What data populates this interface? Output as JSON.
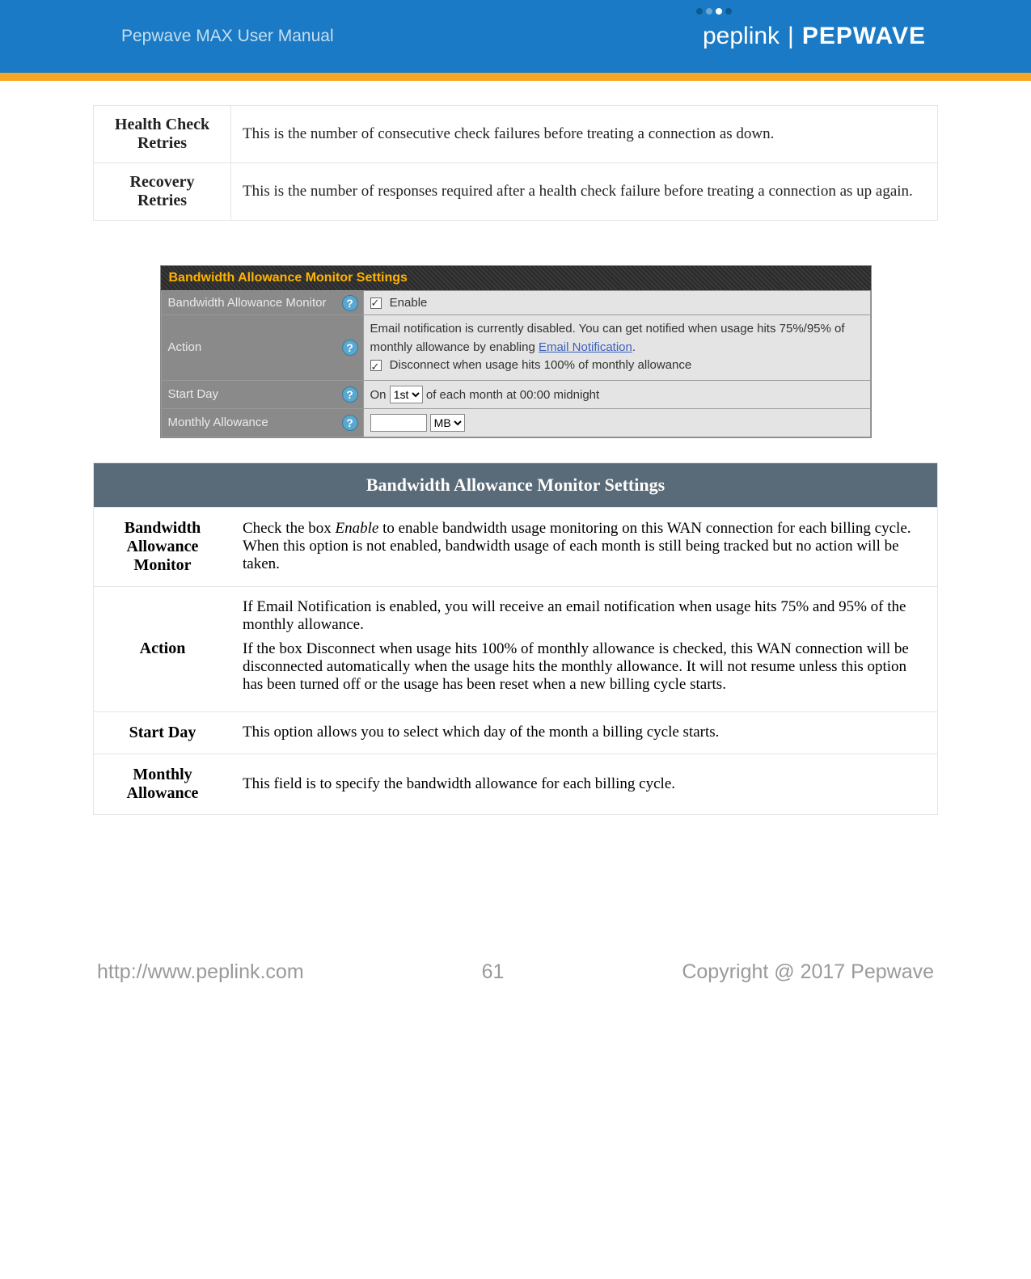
{
  "header": {
    "title": "Pepwave MAX User Manual",
    "brand_left": "peplink",
    "brand_right": "PEPWAVE"
  },
  "desc_table": [
    {
      "label": "Health Check Retries",
      "text": "This is the number of consecutive check failures before treating a connection as down."
    },
    {
      "label": "Recovery Retries",
      "text": "This is the number of responses required after a health check failure before treating a connection as up again."
    }
  ],
  "settings_panel": {
    "title": "Bandwidth Allowance Monitor Settings",
    "rows": {
      "bam": {
        "key": "Bandwidth Allowance Monitor",
        "enable_label": "Enable",
        "enable_checked": true
      },
      "action": {
        "key": "Action",
        "text_prefix": "Email notification is currently disabled. You can get notified when usage hits 75%/95% of monthly allowance by enabling ",
        "link": "Email Notification",
        "text_suffix": ".",
        "disconnect_label": "Disconnect when usage hits 100% of monthly allowance",
        "disconnect_checked": true
      },
      "start_day": {
        "key": "Start Day",
        "prefix": "On",
        "options": [
          "1st"
        ],
        "selected": "1st",
        "suffix": "of each month at 00:00 midnight"
      },
      "monthly": {
        "key": "Monthly Allowance",
        "value": "",
        "units": [
          "MB"
        ],
        "selected_unit": "MB"
      }
    }
  },
  "desc2": {
    "title": "Bandwidth Allowance Monitor Settings",
    "rows": [
      {
        "label": "Bandwidth Allowance Monitor",
        "paras": [
          {
            "pre": "Check the box ",
            "em": "Enable",
            "post": " to enable bandwidth usage monitoring on this WAN connection for each billing cycle. When this option is not enabled, bandwidth usage of each month is still being tracked but no action will be taken."
          }
        ]
      },
      {
        "label": "Action",
        "paras": [
          {
            "pre": "If Email Notification is enabled, you will receive an email notification when usage hits 75% and 95% of the monthly allowance.",
            "em": "",
            "post": ""
          },
          {
            "pre": "If the box Disconnect when usage hits 100% of monthly allowance is checked, this WAN connection will be disconnected automatically when the usage hits the monthly allowance. It will not resume unless this option has been turned off or the usage has been reset when a new billing cycle starts.",
            "em": "",
            "post": ""
          }
        ]
      },
      {
        "label": "Start Day",
        "paras": [
          {
            "pre": "This option allows you to select which day of the month a billing cycle starts.",
            "em": "",
            "post": ""
          }
        ]
      },
      {
        "label": "Monthly Allowance",
        "paras": [
          {
            "pre": "This field is to specify the bandwidth allowance for each billing cycle.",
            "em": "",
            "post": ""
          }
        ]
      }
    ]
  },
  "footer": {
    "url": "http://www.peplink.com",
    "page": "61",
    "copyright": "Copyright @ 2017 Pepwave"
  }
}
